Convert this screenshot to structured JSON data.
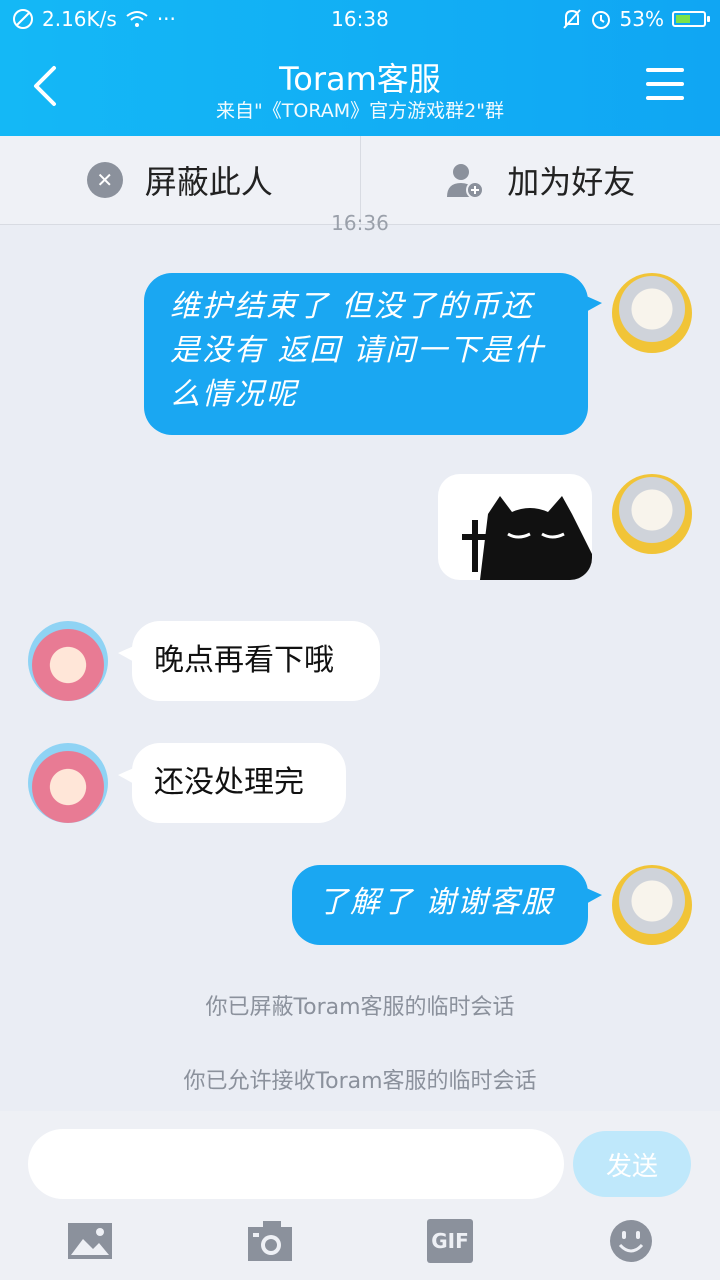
{
  "status_bar": {
    "net_speed": "2.16K/s",
    "more": "···",
    "time": "16:38",
    "battery_percent": "53%",
    "battery_level": 0.53
  },
  "header": {
    "title": "Toram客服",
    "subtitle": "来自\"《TORAM》官方游戏群2\"群"
  },
  "actions": {
    "block_label": "屏蔽此人",
    "add_friend_label": "加为好友"
  },
  "timestamp": "16:36",
  "messages": [
    {
      "side": "out",
      "text": "维护结束了 但没了的币还是没有 返回 请问一下是什么情况呢"
    },
    {
      "side": "out",
      "type": "sticker",
      "icon": "black-cat-cross-sticker"
    },
    {
      "side": "in",
      "text": "晚点再看下哦"
    },
    {
      "side": "in",
      "text": "还没处理完"
    },
    {
      "side": "out",
      "text": "了解了 谢谢客服"
    }
  ],
  "system_notes": [
    "你已屏蔽Toram客服的临时会话",
    "你已允许接收Toram客服的临时会话"
  ],
  "input": {
    "value": "",
    "send_label": "发送"
  },
  "toolbar": {
    "icons": [
      "image-icon",
      "camera-icon",
      "gif-icon",
      "emoji-icon"
    ],
    "gif_label": "GIF"
  },
  "colors": {
    "header_blue": "#14b8f6",
    "bubble_out": "#1aa7f2",
    "bubble_in": "#ffffff",
    "background": "#eaedf4",
    "send_disabled": "#bfe8fb",
    "battery_green": "#7be34a"
  }
}
